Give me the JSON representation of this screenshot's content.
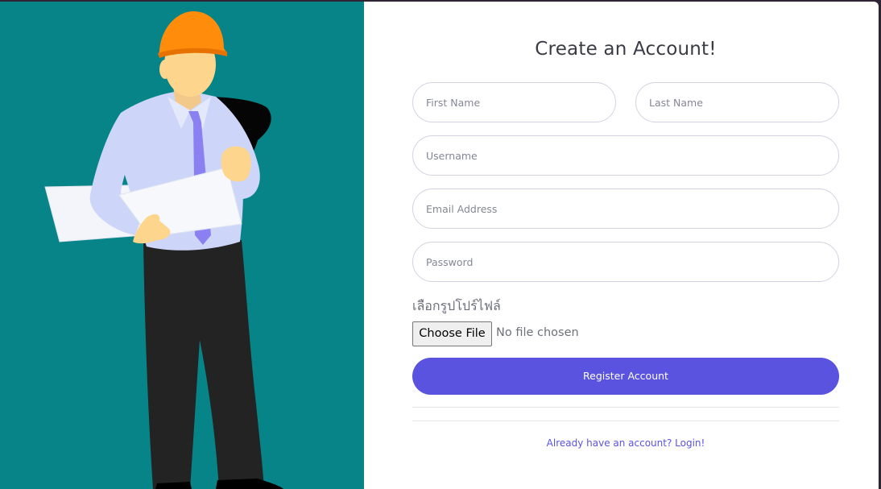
{
  "form": {
    "title": "Create an Account!",
    "first_name_placeholder": "First Name",
    "last_name_placeholder": "Last Name",
    "username_placeholder": "Username",
    "email_placeholder": "Email Address",
    "password_placeholder": "Password",
    "profile_picture_label": "เลือกรูปโปร์ไฟล์",
    "choose_file_label": "Choose File",
    "file_status": "No file chosen",
    "register_label": "Register Account",
    "login_link_label": "Already have an account? Login!"
  },
  "colors": {
    "illustration_bg": "#068488",
    "primary": "#5a53e0",
    "helmet": "#ff8c0a",
    "shirt": "#cdd6f8",
    "tie": "#8b80f2"
  },
  "icons": {
    "illustration": "engineer-with-blueprint-illustration"
  }
}
